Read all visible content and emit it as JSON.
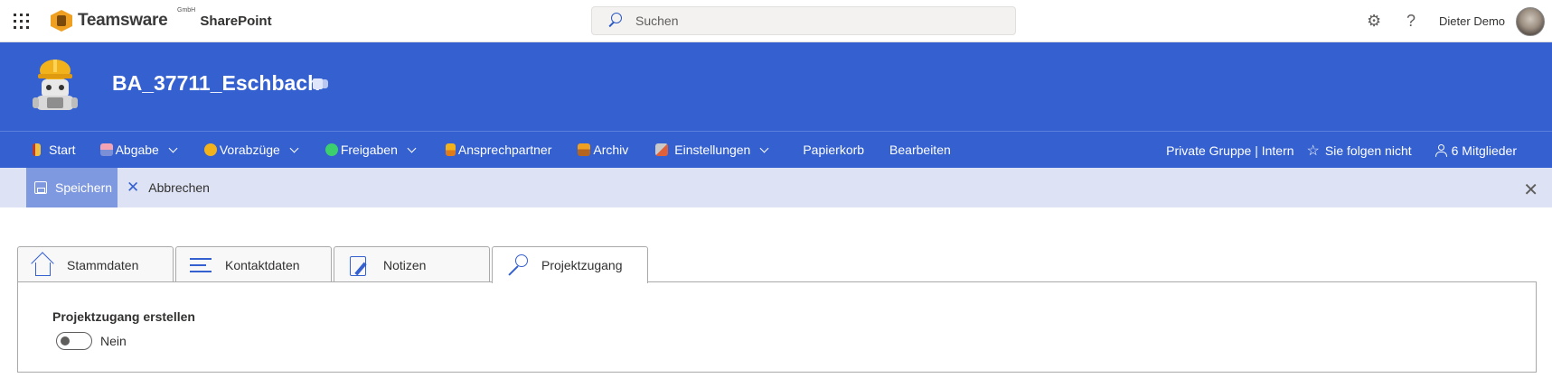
{
  "suite_bar": {
    "brand_name": "Teamsware",
    "brand_suffix": "GmbH",
    "app_name": "SharePoint",
    "search_placeholder": "Suchen",
    "user_name": "Dieter Demo"
  },
  "site": {
    "title": "BA_37711_Eschbach"
  },
  "nav": {
    "items": [
      {
        "label": "Start",
        "icon": "start-icon",
        "has_dropdown": false
      },
      {
        "label": "Abgabe",
        "icon": "abgabe-icon",
        "has_dropdown": true
      },
      {
        "label": "Vorabzüge",
        "icon": "vorabzuege-icon",
        "has_dropdown": true
      },
      {
        "label": "Freigaben",
        "icon": "freigaben-icon",
        "has_dropdown": true
      },
      {
        "label": "Ansprechpartner",
        "icon": "ansprechpartner-icon",
        "has_dropdown": false
      },
      {
        "label": "Archiv",
        "icon": "archiv-icon",
        "has_dropdown": false
      },
      {
        "label": "Einstellungen",
        "icon": "einstellungen-icon",
        "has_dropdown": true
      },
      {
        "label": "Papierkorb",
        "has_dropdown": false
      },
      {
        "label": "Bearbeiten",
        "has_dropdown": false
      }
    ],
    "group_info": "Private Gruppe | Intern",
    "follow_label": "Sie folgen nicht",
    "members_label": "6 Mitglieder"
  },
  "command_bar": {
    "save_label": "Speichern",
    "cancel_label": "Abbrechen"
  },
  "tabs": [
    {
      "label": "Stammdaten",
      "icon": "home-icon",
      "active": false
    },
    {
      "label": "Kontaktdaten",
      "icon": "lines-icon",
      "active": false
    },
    {
      "label": "Notizen",
      "icon": "notes-icon",
      "active": false
    },
    {
      "label": "Projektzugang",
      "icon": "key-icon",
      "active": true
    }
  ],
  "panel": {
    "field_label": "Projektzugang erstellen",
    "toggle_state": false,
    "toggle_text": "Nein"
  },
  "colors": {
    "site_header": "#3560d0",
    "command_bar": "#dde3f5",
    "save_button": "#7f99e0"
  }
}
